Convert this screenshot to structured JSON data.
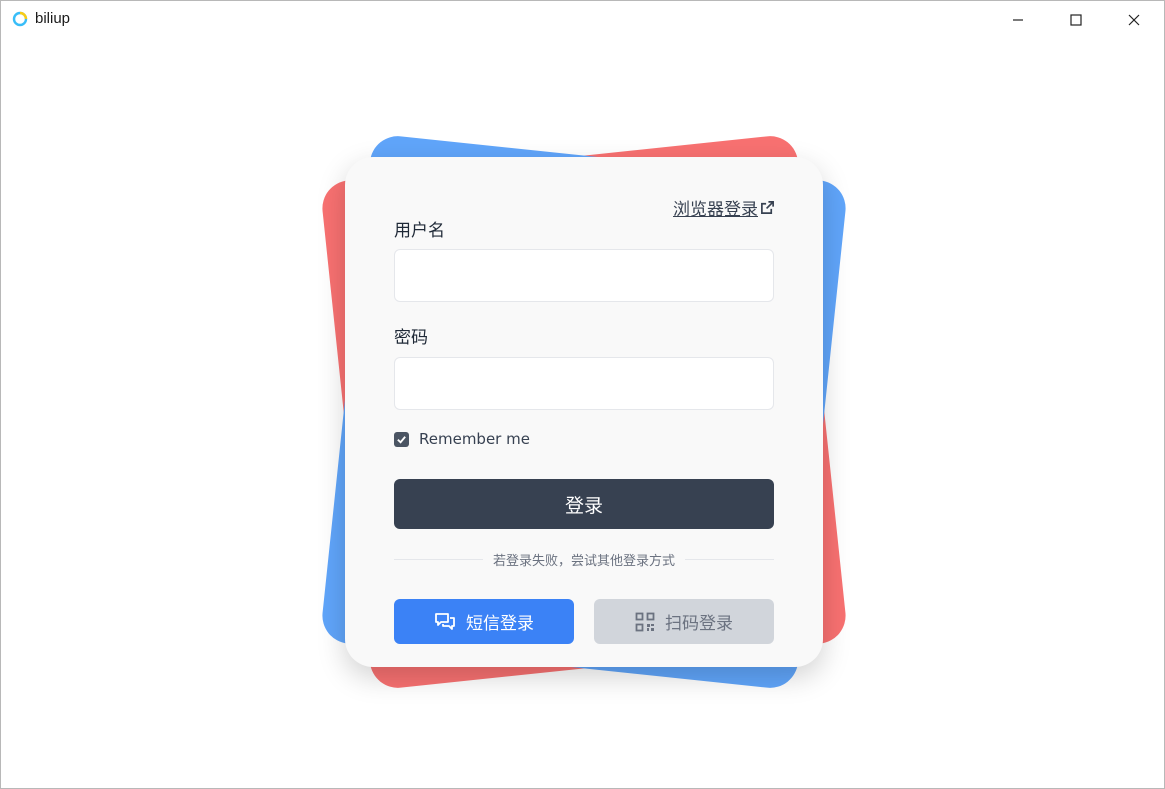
{
  "window": {
    "title": "biliup",
    "app_icon": "biliup-logo-icon",
    "controls": [
      "minimize-icon",
      "maximize-icon",
      "close-icon"
    ]
  },
  "colors": {
    "card_red": "#f87171",
    "card_blue": "#60a5fa",
    "primary_button": "#374151",
    "sms_button": "#3b82f6",
    "qr_button": "#d1d5db"
  },
  "login": {
    "browser_login_link": "浏览器登录",
    "username_label": "用户名",
    "username_value": "",
    "password_label": "密码",
    "password_value": "",
    "remember_label": "Remember me",
    "remember_checked": true,
    "submit_label": "登录",
    "divider_text": "若登录失败，尝试其他登录方式",
    "sms_login_label": "短信登录",
    "qr_login_label": "扫码登录"
  }
}
